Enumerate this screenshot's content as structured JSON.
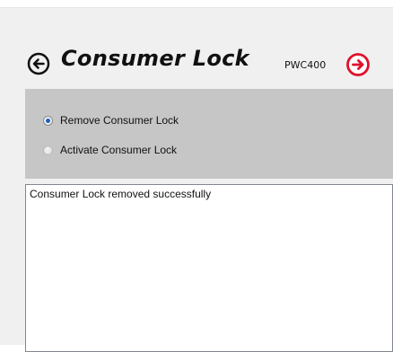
{
  "header": {
    "title": "Consumer Lock",
    "model": "PWC400",
    "back_icon": "back-arrow-circle-icon",
    "next_icon": "next-arrow-circle-icon",
    "next_icon_color": "#e0102a"
  },
  "options": {
    "items": [
      {
        "label": "Remove Consumer Lock",
        "selected": true
      },
      {
        "label": "Activate Consumer Lock",
        "selected": false
      }
    ]
  },
  "output": {
    "text": "Consumer Lock removed successfully"
  }
}
